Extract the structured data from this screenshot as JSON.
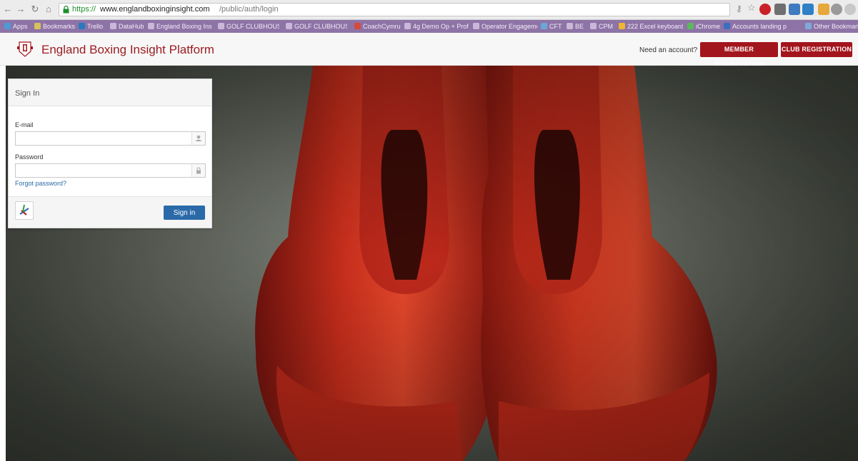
{
  "browser": {
    "url_secure": "https://",
    "url_host": "www.englandboxinginsight.com",
    "url_path": "/public/auth/login",
    "bookmarks": [
      "Apps",
      "Bookmarks",
      "Trello",
      "DataHub",
      "England Boxing Ins",
      "GOLF CLUBHOUSE",
      "GOLF CLUBHOUSE",
      "CoachCymru",
      "4g Demo Op + Prof",
      "Operator Engageme",
      "CFT",
      "BE",
      "CPM",
      "222 Excel keyboard",
      "iChrome",
      "Accounts landing p",
      "Other Bookmarks"
    ]
  },
  "header": {
    "site_title": "England Boxing Insight Platform",
    "need_account": "Need an account?",
    "member_registration": "MEMBER REGISTRATION",
    "club_registration": "CLUB REGISTRATION"
  },
  "signin": {
    "title": "Sign In",
    "email_label": "E-mail",
    "email_value": "",
    "password_label": "Password",
    "password_value": "",
    "forgot": "Forgot password?",
    "submit": "Sign in"
  },
  "colors": {
    "brand_red": "#a3151c",
    "link_blue": "#2a6aa8",
    "bookmark_bar": "#8e73a7"
  }
}
